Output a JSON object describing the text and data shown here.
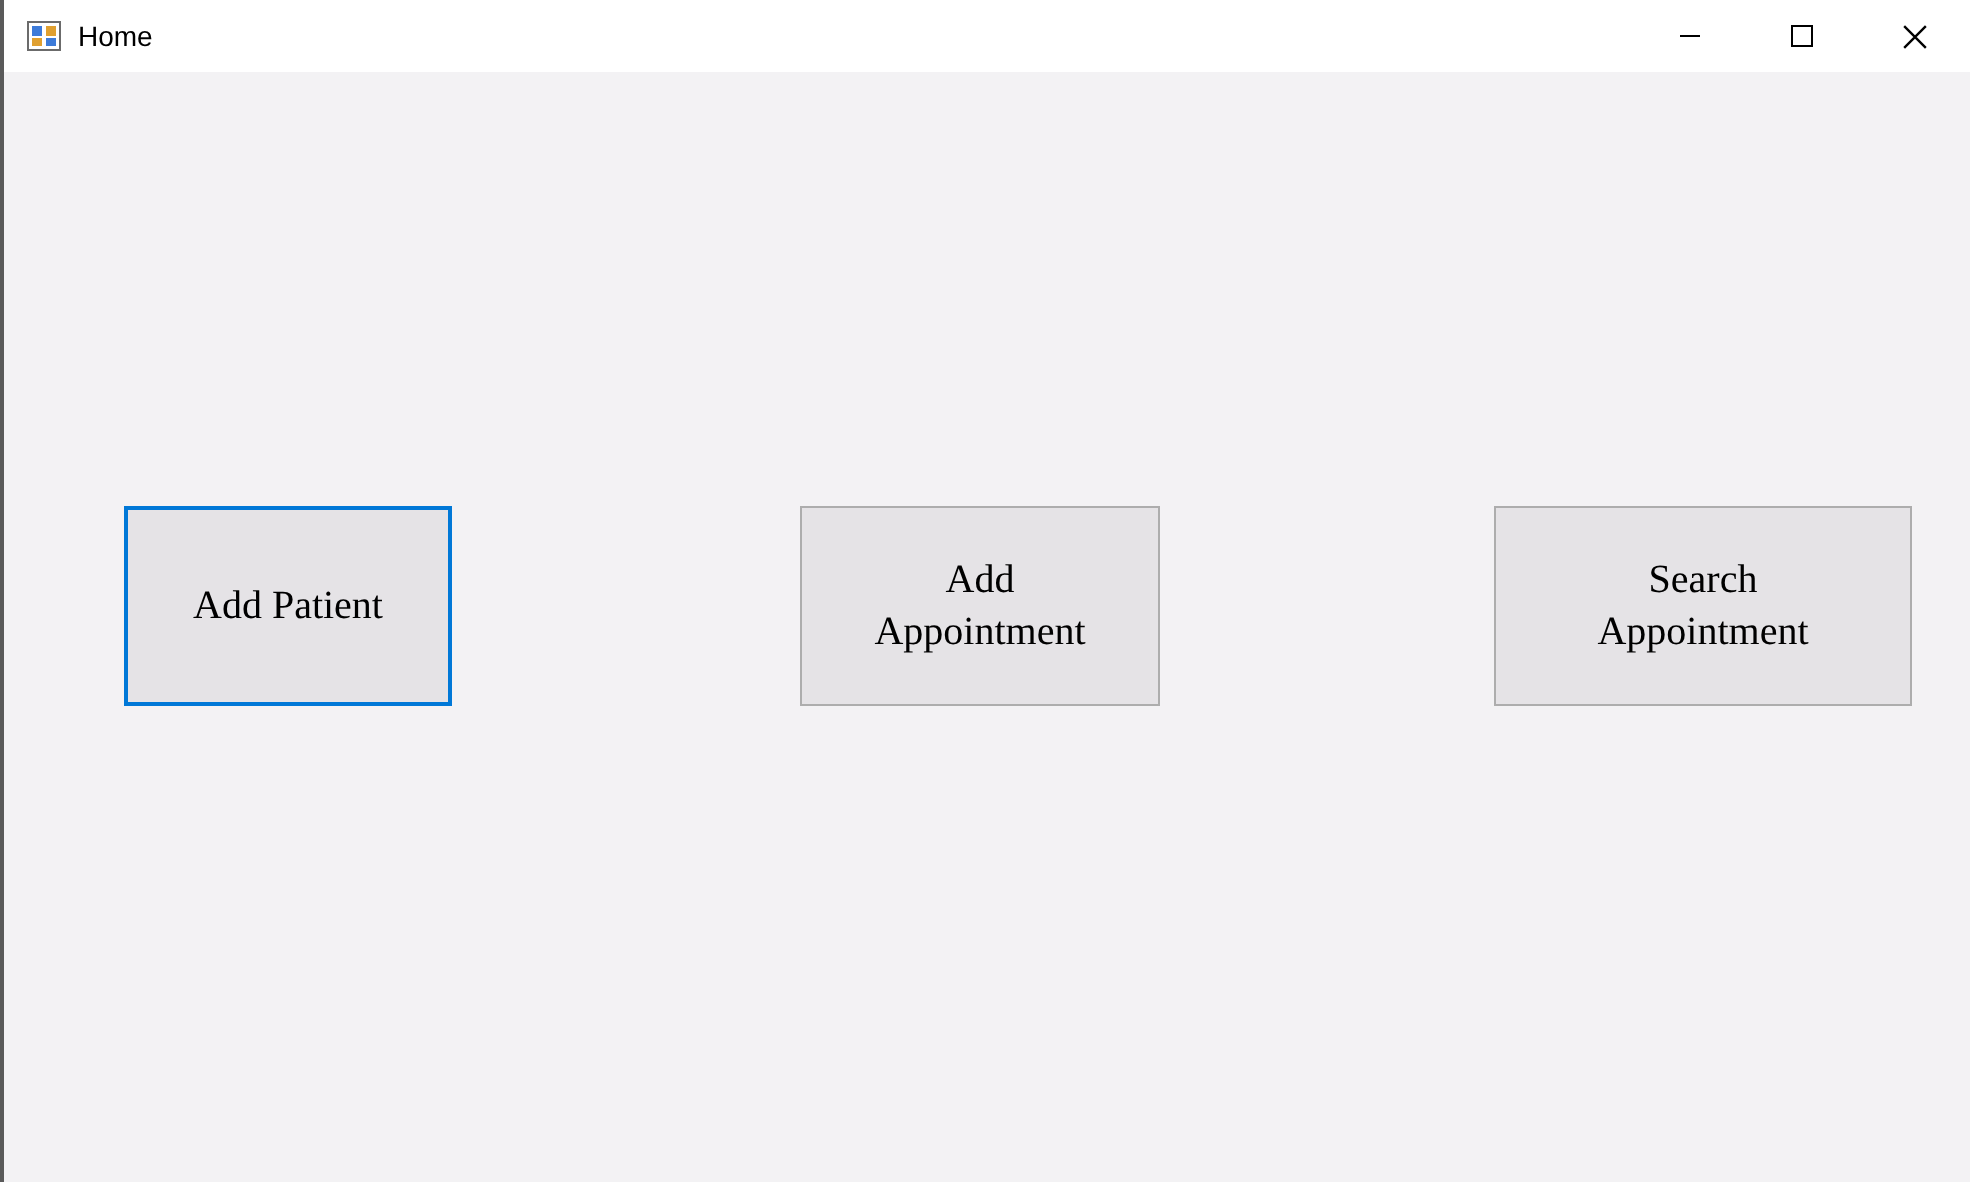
{
  "window": {
    "title": "Home"
  },
  "buttons": [
    {
      "lines": [
        "Add Patient"
      ],
      "focused": true
    },
    {
      "lines": [
        "Add",
        "Appointment"
      ],
      "focused": false
    },
    {
      "lines": [
        "Search",
        "Appointment"
      ],
      "focused": false
    }
  ]
}
